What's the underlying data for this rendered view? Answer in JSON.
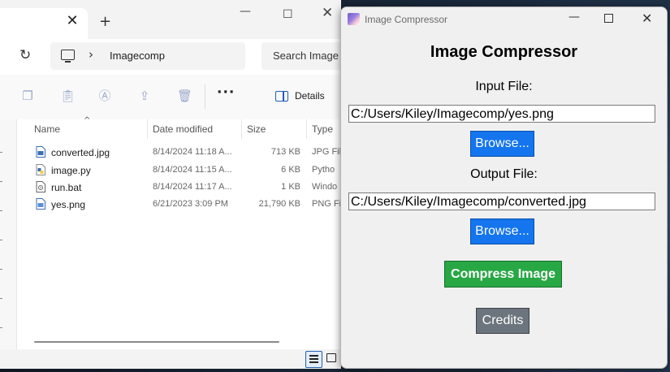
{
  "explorer": {
    "tab_close_glyph": "✕",
    "new_tab_glyph": "+",
    "window_controls": {
      "minimize": "—",
      "maximize": "☐",
      "close": "✕"
    },
    "breadcrumb": "Imagecomp",
    "search_placeholder": "Search Image",
    "toolbar": {
      "icons": [
        "copy-icon",
        "paste-icon",
        "rename-icon",
        "share-icon",
        "delete-icon"
      ],
      "more_label": "···",
      "details_label": "Details"
    },
    "columns": [
      "Name",
      "Date modified",
      "Size",
      "Type"
    ],
    "files": [
      {
        "name": "converted.jpg",
        "date": "8/14/2024 11:18 A...",
        "size": "713 KB",
        "type": "JPG Fil",
        "icon": "jpg-file-icon"
      },
      {
        "name": "image.py",
        "date": "8/14/2024 11:15 A...",
        "size": "6 KB",
        "type": "Pytho",
        "icon": "python-file-icon"
      },
      {
        "name": "run.bat",
        "date": "8/14/2024 11:17 A...",
        "size": "1 KB",
        "type": "Windo",
        "icon": "batch-file-icon"
      },
      {
        "name": "yes.png",
        "date": "6/21/2023 3:09 PM",
        "size": "21,790 KB",
        "type": "PNG Fi",
        "icon": "png-file-icon"
      }
    ]
  },
  "app": {
    "title": "Image Compressor",
    "window_controls": {
      "minimize": "—",
      "close": "✕"
    },
    "heading": "Image Compressor",
    "input_label": "Input File:",
    "input_path": "C:/Users/Kiley/Imagecomp/yes.png",
    "browse_input_label": "Browse...",
    "output_label": "Output File:",
    "output_path": "C:/Users/Kiley/Imagecomp/converted.jpg",
    "browse_output_label": "Browse...",
    "compress_label": "Compress Image",
    "credits_label": "Credits",
    "colors": {
      "browse": "#1475ee",
      "compress": "#28a745",
      "credits": "#6c757d"
    }
  }
}
